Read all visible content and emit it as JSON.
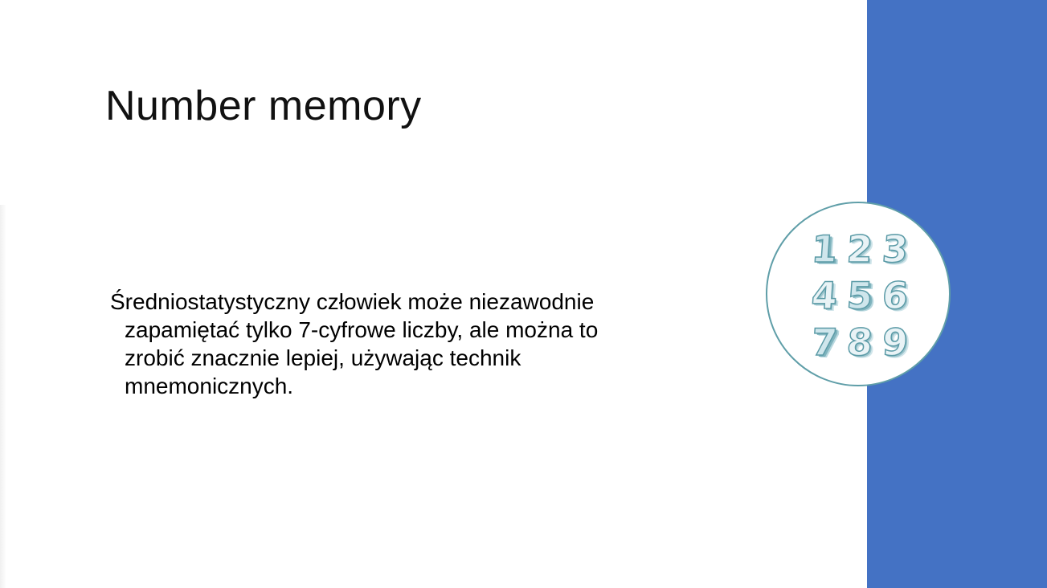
{
  "slide": {
    "title": "Number memory",
    "body": "Średniostatystyczny człowiek może niezawodnie zapamiętać tylko 7-cyfrowe liczby, ale można to zrobić znacznie lepiej, używając technik mnemonicznych."
  },
  "illustration": {
    "icon": "digits-1-to-9-icon",
    "digits": [
      "1",
      "2",
      "3",
      "4",
      "5",
      "6",
      "7",
      "8",
      "9"
    ]
  },
  "colors": {
    "accent_bar": "#4472C4",
    "circle_border": "#5F9EA8",
    "text": "#000000"
  }
}
